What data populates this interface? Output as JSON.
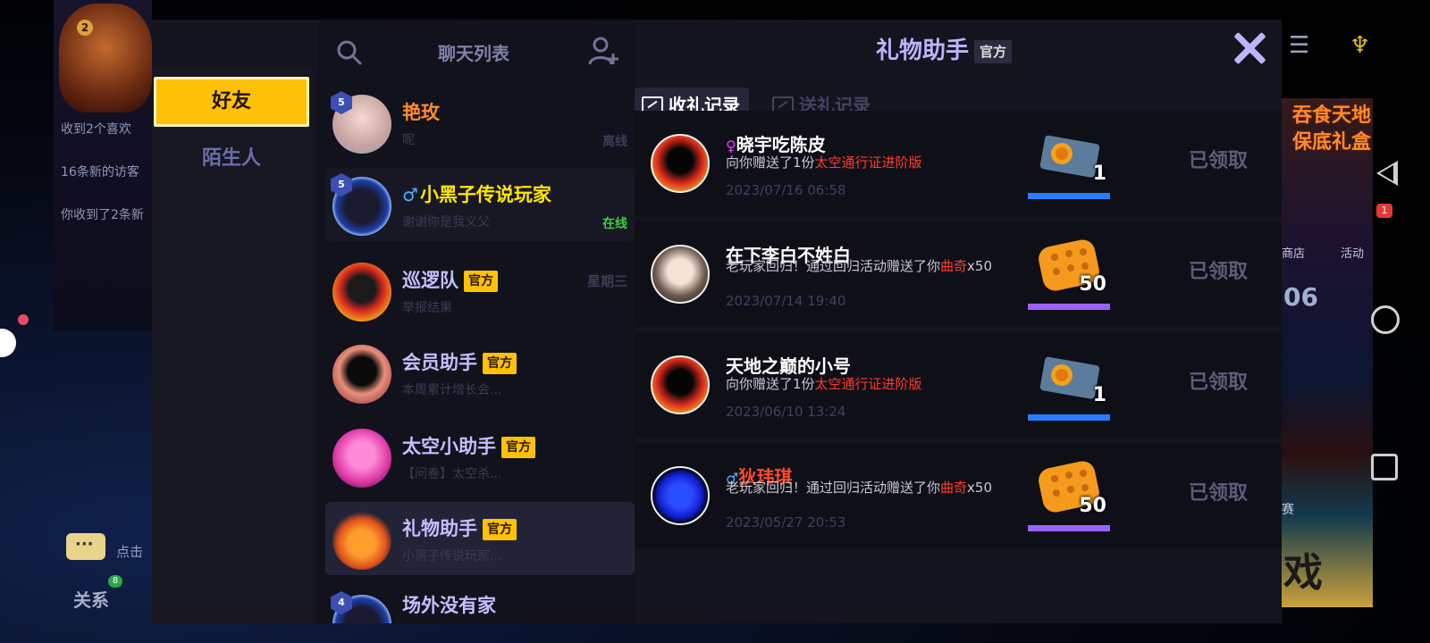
{
  "background": {
    "notes": [
      "收到2个喜欢",
      "16条新的访客",
      "你收到了2条新"
    ],
    "badge_level": "2",
    "chat_hint": "点击",
    "relation_label": "关系",
    "relation_badge": "8",
    "promo_text": "吞食天地 保底礼盒",
    "shop_label": "商店",
    "activity_label": "活动",
    "activity_badge": "1",
    "number": "06",
    "match_label": "赛",
    "play_text": "戏"
  },
  "sidebar": {
    "tabs": [
      {
        "label": "好友",
        "active": true
      },
      {
        "label": "陌生人",
        "active": false
      }
    ]
  },
  "chat_list": {
    "title": "聊天列表",
    "items": [
      {
        "name": "艳玫",
        "sub": "呢",
        "status": "离线",
        "level": "5",
        "name_color": "#ff8c2b"
      },
      {
        "name": "小黑子传说玩家",
        "sub": "谢谢你是我义父",
        "status": "在线",
        "level": "5",
        "name_color": "#ffe600",
        "gender": "♂"
      },
      {
        "name": "巡逻队",
        "official": "官方",
        "sub": "举报结果",
        "date": "星期三"
      },
      {
        "name": "会员助手",
        "official": "官方",
        "sub": "本周累计增长会..."
      },
      {
        "name": "太空小助手",
        "official": "官方",
        "sub": "【问卷】太空杀..."
      },
      {
        "name": "礼物助手",
        "official": "官方",
        "sub": "小黑子传说玩家..."
      },
      {
        "name": "场外没有家",
        "level": "4"
      }
    ]
  },
  "gift_panel": {
    "title": "礼物助手",
    "official": "官方",
    "tabs": [
      {
        "label": "收礼记录",
        "active": true
      },
      {
        "label": "送礼记录",
        "active": false
      }
    ],
    "records": [
      {
        "sender": "晓宇吃陈皮",
        "gender": "♀",
        "msg_pre": "向你赠送了1份",
        "msg_hl": "太空通行证进阶版",
        "msg_post": "",
        "time": "2023/07/16 06:58",
        "qty": "1",
        "item": "pass",
        "status": "已领取"
      },
      {
        "sender": "在下李白不姓白",
        "gender": "",
        "msg_pre": "老玩家回归！通过回归活动赠送了你",
        "msg_hl": "曲奇",
        "msg_post": "x50",
        "time": "2023/07/14 19:40",
        "qty": "50",
        "item": "cookie",
        "status": "已领取"
      },
      {
        "sender": "天地之巅的小号",
        "gender": "",
        "msg_pre": "向你赠送了1份",
        "msg_hl": "太空通行证进阶版",
        "msg_post": "",
        "time": "2023/06/10 13:24",
        "qty": "1",
        "item": "pass",
        "status": "已领取"
      },
      {
        "sender": "狄玮琪",
        "gender": "♂",
        "msg_pre": "老玩家回归！通过回归活动赠送了你",
        "msg_hl": "曲奇",
        "msg_post": "x50",
        "time": "2023/05/27 20:53",
        "qty": "50",
        "item": "cookie",
        "status": "已领取"
      }
    ]
  },
  "colors": {
    "accent": "#ffc107",
    "title": "#b9b6ff",
    "highlight_red": "#ff3d2e",
    "online_green": "#3ecf3e"
  }
}
